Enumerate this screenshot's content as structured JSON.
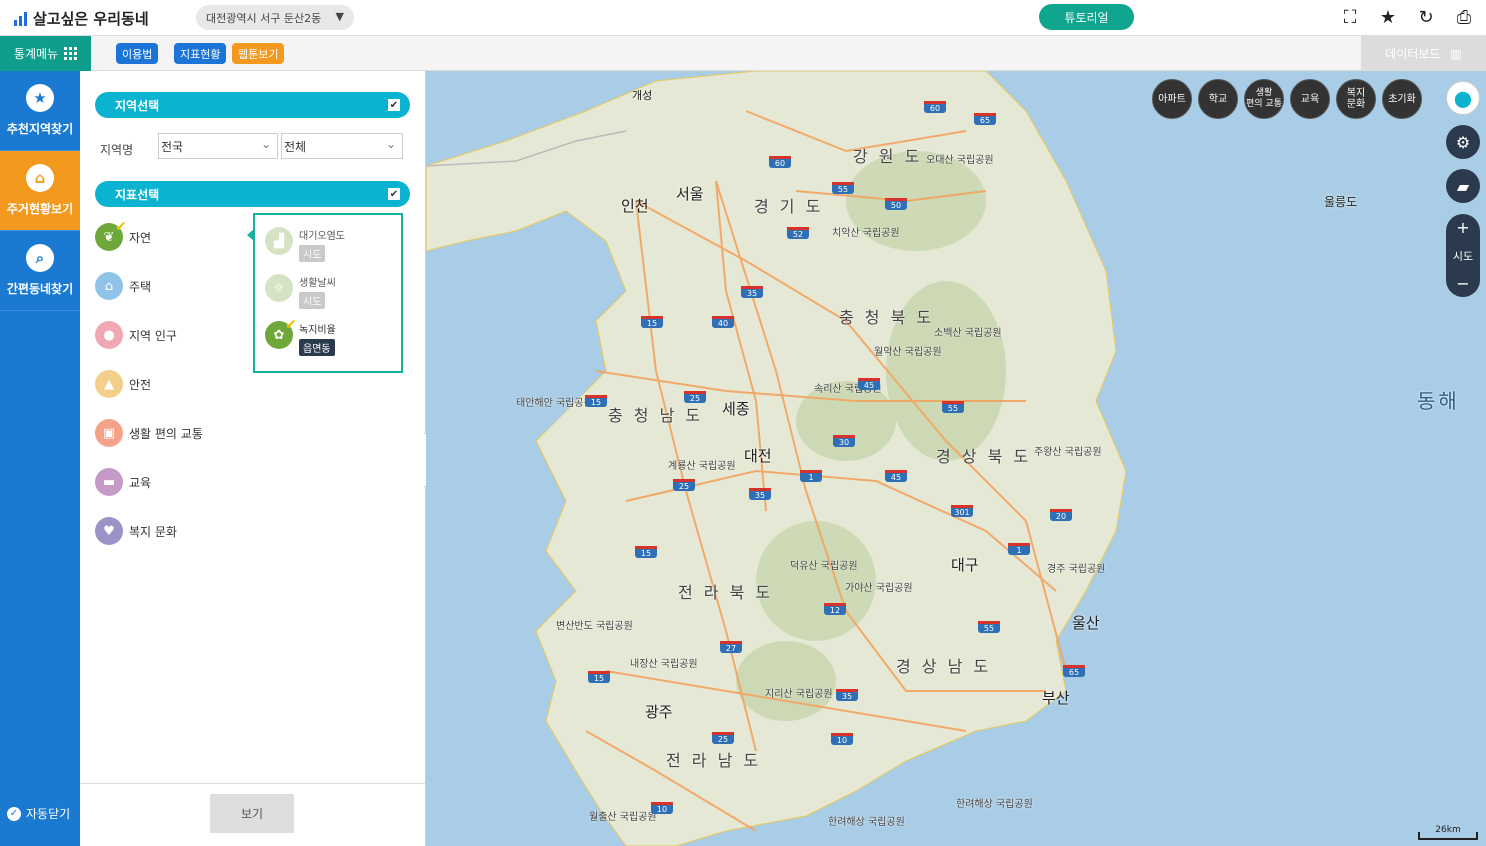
{
  "header": {
    "app_title": "살고싶은 우리동네",
    "location": "대전광역시 서구 둔산2동",
    "tutorial_label": "튜토리얼"
  },
  "menubar": {
    "stat_menu_label": "통계메뉴",
    "usage_label": "이용법",
    "indicator_status_label": "지표현황",
    "webtoon_label": "웹툰보기",
    "dashboard_label": "데이터보드"
  },
  "sidenav": {
    "items": [
      {
        "label": "추천지역찾기"
      },
      {
        "label": "주거현황보기"
      },
      {
        "label": "간편동네찾기"
      }
    ],
    "auto_close_label": "자동닫기"
  },
  "panel": {
    "region_section": "지역선택",
    "region_label": "지역명",
    "region_select_1": "전국",
    "region_select_2": "전체",
    "indicator_section": "지표선택",
    "indicators": [
      {
        "label": "자연",
        "color": "#6ea83a"
      },
      {
        "label": "주택",
        "color": "#8fc3e8"
      },
      {
        "label": "지역 인구",
        "color": "#f2a8b4"
      },
      {
        "label": "안전",
        "color": "#f2d08c"
      },
      {
        "label": "생활 편의 교통",
        "color": "#f4a38a"
      },
      {
        "label": "교육",
        "color": "#c69ac6"
      },
      {
        "label": "복지 문화",
        "color": "#9a93c7"
      }
    ],
    "sub_indicators": [
      {
        "name": "대기오염도",
        "tag": "시도"
      },
      {
        "name": "생활날씨",
        "tag": "시도"
      },
      {
        "name": "녹지비율",
        "tag": "읍면동"
      }
    ],
    "view_button": "보기"
  },
  "map": {
    "poi_buttons": [
      "아파트",
      "학교",
      "생활\n편의 교통",
      "교육",
      "복지\n문화",
      "초기화"
    ],
    "zoom_level": "시도",
    "scale_label": "26km",
    "provinces": [
      "강 원 도",
      "경 기 도",
      "충 청 북 도",
      "충 청 남 도",
      "경 상 북 도",
      "전 라 북 도",
      "경 상 남 도",
      "전 라 남 도"
    ],
    "cities": [
      "서울",
      "인천",
      "세종",
      "대전",
      "대구",
      "울산",
      "부산",
      "광주",
      "개성"
    ],
    "sea_label": "동해",
    "island_label": "울릉도",
    "parks": [
      "오대산\n국립공원",
      "치악산\n국립공원",
      "소백산\n국립공원",
      "월악산\n국립공원",
      "속리산\n국립공원",
      "태안해안\n국립공원",
      "계룡산\n국립공원",
      "주왕산\n국립공원",
      "덕유산\n국립공원",
      "가야산\n국립공원",
      "경주\n국립공원",
      "변산반도\n국립공원",
      "내장산\n국립공원",
      "지리산\n국립공원",
      "월출산\n국립공원",
      "한려해상\n국립공원",
      "한려해상\n국립공원"
    ],
    "highways": [
      "60",
      "65",
      "60",
      "55",
      "50",
      "52",
      "35",
      "15",
      "40",
      "45",
      "25",
      "15",
      "55",
      "30",
      "25",
      "35",
      "1",
      "45",
      "301",
      "20",
      "15",
      "1",
      "12",
      "55",
      "27",
      "65",
      "15",
      "35",
      "25",
      "10",
      "10"
    ]
  }
}
